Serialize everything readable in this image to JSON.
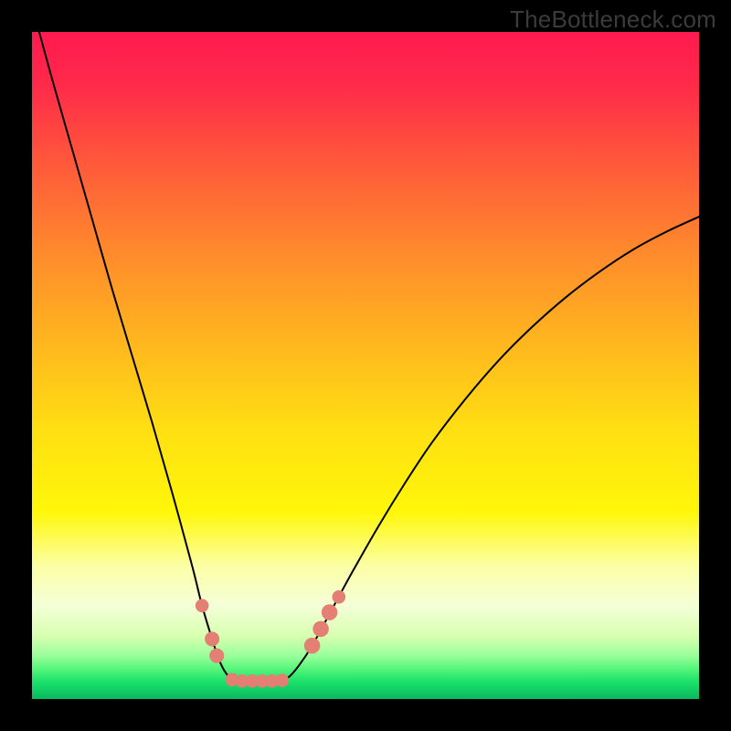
{
  "watermark": "TheBottleneck.com",
  "chart_data": {
    "type": "line",
    "title": "",
    "xlabel": "",
    "ylabel": "",
    "xlim": [
      0,
      100
    ],
    "ylim": [
      0,
      100
    ],
    "grid": false,
    "legend": null,
    "annotations": [],
    "background_gradient": {
      "stops": [
        {
          "pos": 0.0,
          "color": "#ff1a4f"
        },
        {
          "pos": 0.08,
          "color": "#ff2a4a"
        },
        {
          "pos": 0.2,
          "color": "#ff5a3a"
        },
        {
          "pos": 0.33,
          "color": "#ff8a2c"
        },
        {
          "pos": 0.47,
          "color": "#ffb81e"
        },
        {
          "pos": 0.6,
          "color": "#ffe012"
        },
        {
          "pos": 0.72,
          "color": "#fff70a"
        },
        {
          "pos": 0.8,
          "color": "#fcffa5"
        },
        {
          "pos": 0.86,
          "color": "#f4ffd8"
        },
        {
          "pos": 0.905,
          "color": "#d8ffb0"
        },
        {
          "pos": 0.935,
          "color": "#9aff9a"
        },
        {
          "pos": 0.955,
          "color": "#55f57a"
        },
        {
          "pos": 0.975,
          "color": "#19e06a"
        },
        {
          "pos": 1.0,
          "color": "#0bb85e"
        }
      ]
    },
    "series": [
      {
        "name": "bottleneck-curve",
        "color": "#000000",
        "width": 2,
        "x": [
          0.0,
          3.0,
          6.0,
          9.0,
          12.0,
          15.0,
          18.0,
          21.0,
          24.0,
          25.5,
          27.0,
          28.0,
          29.0,
          30.0,
          31.5,
          33.0,
          35.0,
          37.0,
          38.5,
          40.0,
          42.0,
          45.0,
          48.0,
          52.0,
          56.0,
          60.0,
          65.0,
          70.0,
          75.0,
          80.0,
          85.0,
          90.0,
          95.0,
          100.0
        ],
        "y": [
          104.0,
          93.0,
          82.5,
          72.0,
          61.5,
          51.5,
          41.5,
          31.0,
          20.0,
          14.0,
          9.0,
          6.0,
          4.0,
          3.0,
          2.7,
          2.7,
          2.7,
          2.7,
          3.3,
          5.0,
          8.0,
          13.5,
          19.0,
          26.0,
          32.5,
          38.5,
          45.0,
          50.8,
          55.8,
          60.2,
          64.0,
          67.3,
          70.0,
          72.3
        ]
      }
    ],
    "markers": [
      {
        "name": "marker-left-upper",
        "x": 25.5,
        "y": 14.0,
        "r": 1.0,
        "color": "#e38073"
      },
      {
        "name": "marker-left-a",
        "x": 27.0,
        "y": 9.0,
        "r": 1.1,
        "color": "#e38073"
      },
      {
        "name": "marker-left-b",
        "x": 27.7,
        "y": 6.5,
        "r": 1.1,
        "color": "#e38073"
      },
      {
        "name": "marker-floor-1",
        "x": 30.0,
        "y": 2.9,
        "r": 1.0,
        "color": "#e38073"
      },
      {
        "name": "marker-floor-2",
        "x": 31.5,
        "y": 2.7,
        "r": 1.0,
        "color": "#e38073"
      },
      {
        "name": "marker-floor-3",
        "x": 33.0,
        "y": 2.7,
        "r": 1.0,
        "color": "#e38073"
      },
      {
        "name": "marker-floor-4",
        "x": 34.5,
        "y": 2.7,
        "r": 1.0,
        "color": "#e38073"
      },
      {
        "name": "marker-floor-5",
        "x": 36.0,
        "y": 2.7,
        "r": 1.0,
        "color": "#e38073"
      },
      {
        "name": "marker-floor-6",
        "x": 37.5,
        "y": 2.8,
        "r": 1.0,
        "color": "#e38073"
      },
      {
        "name": "marker-right-a",
        "x": 42.0,
        "y": 8.0,
        "r": 1.2,
        "color": "#e38073"
      },
      {
        "name": "marker-right-b",
        "x": 43.3,
        "y": 10.5,
        "r": 1.2,
        "color": "#e38073"
      },
      {
        "name": "marker-right-c",
        "x": 44.6,
        "y": 13.0,
        "r": 1.2,
        "color": "#e38073"
      },
      {
        "name": "marker-right-upper",
        "x": 46.0,
        "y": 15.3,
        "r": 1.0,
        "color": "#e38073"
      }
    ]
  }
}
